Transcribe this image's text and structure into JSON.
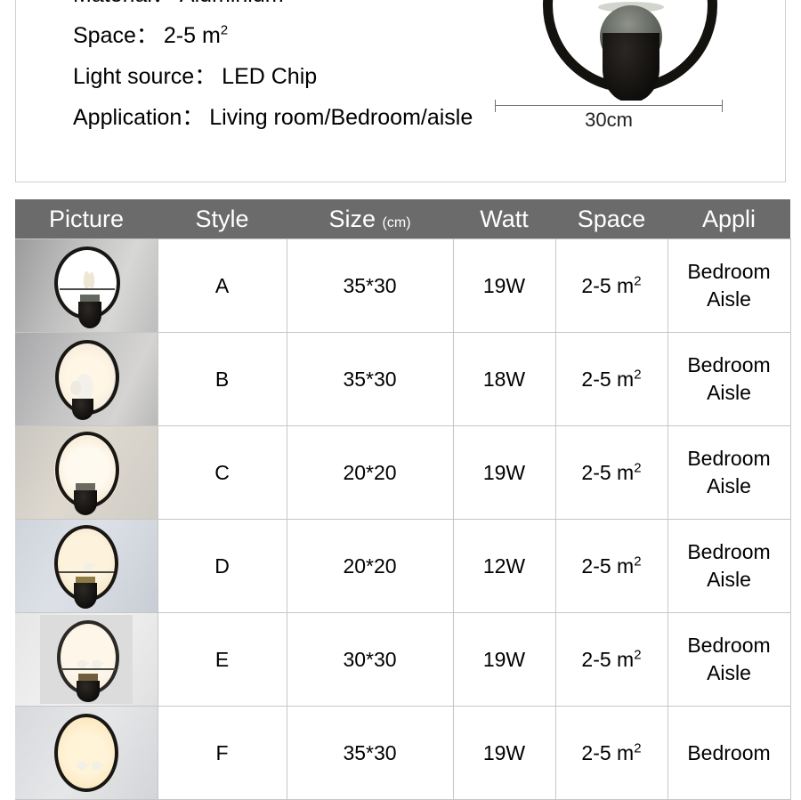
{
  "spec": {
    "rows": [
      {
        "label": "Material",
        "colon": "：",
        "value": "Aluminium"
      },
      {
        "label": "Space",
        "colon": "：",
        "value": "2-5 m",
        "sup": "2"
      },
      {
        "label": "Light source",
        "colon": "：",
        "value": "LED Chip"
      },
      {
        "label": "Application",
        "colon": "：",
        "value": "Living room/Bedroom/aisle"
      }
    ]
  },
  "dimension": {
    "text": "30cm"
  },
  "table": {
    "headers": [
      {
        "label": "Picture",
        "unit": ""
      },
      {
        "label": "Style",
        "unit": ""
      },
      {
        "label": "Size",
        "unit": "(cm)"
      },
      {
        "label": "Watt",
        "unit": ""
      },
      {
        "label": "Space",
        "unit": ""
      },
      {
        "label": "Appli",
        "unit": ""
      }
    ],
    "rows": [
      {
        "style": "A",
        "size": "35*30",
        "watt": "19W",
        "space": "2-5 m",
        "space_sup": "2",
        "appli_line1": "Bedroom",
        "appli_line2": "Aisle",
        "picture": "lamp-a-couple-figurine"
      },
      {
        "style": "B",
        "size": "35*30",
        "watt": "18W",
        "space": "2-5 m",
        "space_sup": "2",
        "appli_line1": "Bedroom",
        "appli_line2": "Aisle",
        "picture": "lamp-b-angel-figurine"
      },
      {
        "style": "C",
        "size": "20*20",
        "watt": "19W",
        "space": "2-5 m",
        "space_sup": "2",
        "appli_line1": "Bedroom",
        "appli_line2": "Aisle",
        "picture": "lamp-c-plain-ring"
      },
      {
        "style": "D",
        "size": "20*20",
        "watt": "12W",
        "space": "2-5 m",
        "space_sup": "2",
        "appli_line1": "Bedroom",
        "appli_line2": "Aisle",
        "picture": "lamp-d-single-bird"
      },
      {
        "style": "E",
        "size": "30*30",
        "watt": "19W",
        "space": "2-5 m",
        "space_sup": "2",
        "appli_line1": "Bedroom",
        "appli_line2": "Aisle",
        "picture": "lamp-e-two-birds"
      },
      {
        "style": "F",
        "size": "35*30",
        "watt": "19W",
        "space": "2-5 m",
        "space_sup": "2",
        "appli_line1": "Bedroom",
        "appli_line2": "",
        "picture": "lamp-f-birds-warm"
      }
    ]
  },
  "colors": {
    "header_bg": "#6b6b6b",
    "header_text": "#ffffff",
    "cell_border": "#c6c6c6",
    "panel_border": "#cfcfcf",
    "lamp_frame": "#191714"
  }
}
